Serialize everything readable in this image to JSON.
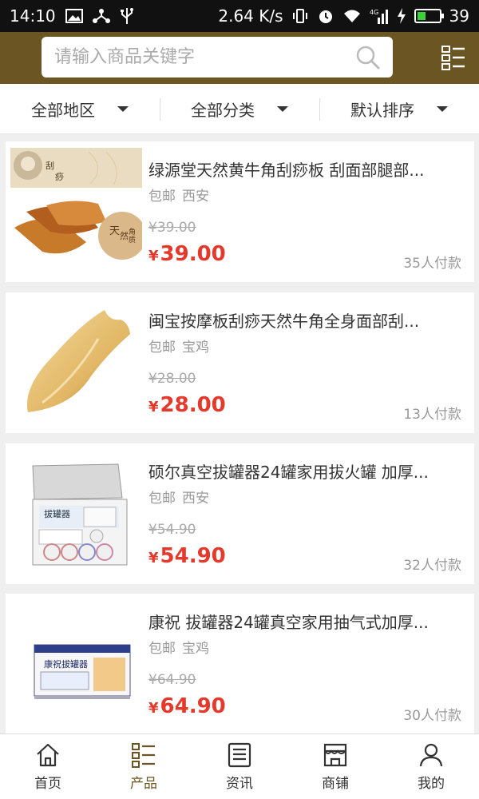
{
  "status_bar": {
    "time": "14:10",
    "speed": "2.64 K/s",
    "network": "4G",
    "battery": "39",
    "battery_level": 0.39
  },
  "search": {
    "placeholder": "请输入商品关键字"
  },
  "filters": [
    {
      "label": "全部地区"
    },
    {
      "label": "全部分类"
    },
    {
      "label": "默认排序"
    }
  ],
  "products": [
    {
      "title": "绿源堂天然黄牛角刮痧板 刮面部腿部...",
      "shipping": "包邮",
      "location": "西安",
      "orig_price": "¥39.00",
      "currency": "¥",
      "price": "39.00",
      "sales": "35人付款",
      "image": "horn-scraping-board-set",
      "image_texts": [
        "刮",
        "痧",
        "天",
        "然",
        "角",
        "质"
      ]
    },
    {
      "title": "闽宝按摩板刮痧天然牛角全身面部刮...",
      "shipping": "包邮",
      "location": "宝鸡",
      "orig_price": "¥28.00",
      "currency": "¥",
      "price": "28.00",
      "sales": "13人付款",
      "image": "horn-scraper"
    },
    {
      "title": "硕尔真空拔罐器24罐家用拔火罐 加厚...",
      "shipping": "包邮",
      "location": "西安",
      "orig_price": "¥54.90",
      "currency": "¥",
      "price": "54.90",
      "sales": "32人付款",
      "image": "cupping-set-box",
      "image_texts": [
        "拔罐器"
      ]
    },
    {
      "title": "康祝 拔罐器24罐真空家用抽气式加厚...",
      "shipping": "包邮",
      "location": "宝鸡",
      "orig_price": "¥64.90",
      "currency": "¥",
      "price": "64.90",
      "sales": "30人付款",
      "image": "cupping-product-box",
      "image_texts": [
        "康祝拔罐器"
      ]
    }
  ],
  "bottom_nav": [
    {
      "label": "首页",
      "icon": "home-icon",
      "active": false
    },
    {
      "label": "产品",
      "icon": "product-list-icon",
      "active": true
    },
    {
      "label": "资讯",
      "icon": "news-icon",
      "active": false
    },
    {
      "label": "商铺",
      "icon": "shop-icon",
      "active": false
    },
    {
      "label": "我的",
      "icon": "user-icon",
      "active": false
    }
  ],
  "colors": {
    "header_bg": "#6b5523",
    "price": "#e4392b",
    "active_nav": "#6b5523"
  }
}
